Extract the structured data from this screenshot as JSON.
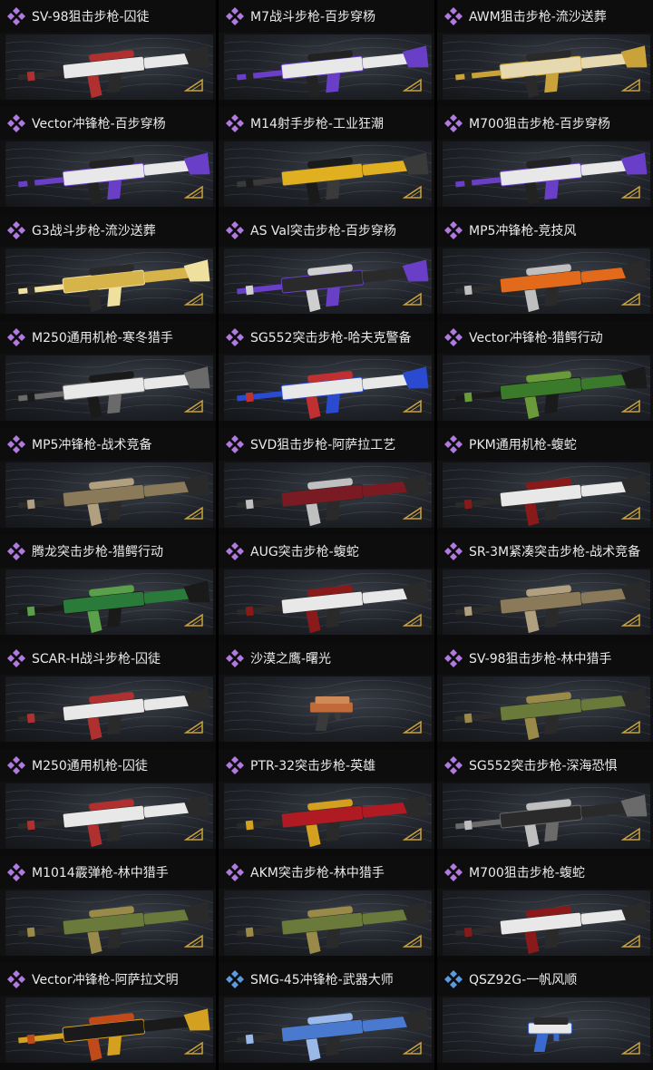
{
  "items": [
    {
      "label": "SV-98狙击步枪-囚徒",
      "rarity": "purple",
      "colors": [
        "#e8e8e8",
        "#2a2a2a",
        "#b03030"
      ]
    },
    {
      "label": "M7战斗步枪-百步穿杨",
      "rarity": "purple",
      "colors": [
        "#e8e8e8",
        "#6a3fc8",
        "#222"
      ]
    },
    {
      "label": "AWM狙击步枪-流沙送葬",
      "rarity": "purple",
      "colors": [
        "#e6d9b0",
        "#c9a23a",
        "#2a2a2a"
      ]
    },
    {
      "label": "Vector冲锋枪-百步穿杨",
      "rarity": "purple",
      "colors": [
        "#e8e8e8",
        "#6a3fc8",
        "#222"
      ]
    },
    {
      "label": "M14射手步枪-工业狂潮",
      "rarity": "purple",
      "colors": [
        "#e0b020",
        "#3a3a3a",
        "#1a1a1a"
      ]
    },
    {
      "label": "M700狙击步枪-百步穿杨",
      "rarity": "purple",
      "colors": [
        "#e8e8e8",
        "#6a3fc8",
        "#222"
      ]
    },
    {
      "label": "G3战斗步枪-流沙送葬",
      "rarity": "purple",
      "colors": [
        "#d6b44a",
        "#f0e0a0",
        "#2a2a2a"
      ]
    },
    {
      "label": "AS Val突击步枪-百步穿杨",
      "rarity": "purple",
      "colors": [
        "#2a2a2a",
        "#6a3fc8",
        "#cfcfcf"
      ]
    },
    {
      "label": "MP5冲锋枪-竞技风",
      "rarity": "purple",
      "colors": [
        "#e36a1a",
        "#2a2a2a",
        "#bfbfbf"
      ]
    },
    {
      "label": "M250通用机枪-寒冬猎手",
      "rarity": "purple",
      "colors": [
        "#e8e8e8",
        "#6a6a6a",
        "#1a1a1a"
      ]
    },
    {
      "label": "SG552突击步枪-哈夫克警备",
      "rarity": "purple",
      "colors": [
        "#e8e8e8",
        "#2a4ad0",
        "#c03030"
      ]
    },
    {
      "label": "Vector冲锋枪-猎鳄行动",
      "rarity": "purple",
      "colors": [
        "#3a7a2a",
        "#1a1a1a",
        "#6a9a3a"
      ]
    },
    {
      "label": "MP5冲锋枪-战术竞备",
      "rarity": "purple",
      "colors": [
        "#8a7a5a",
        "#2a2a2a",
        "#b0a080"
      ]
    },
    {
      "label": "SVD狙击步枪-阿萨拉工艺",
      "rarity": "purple",
      "colors": [
        "#7a1a22",
        "#2a2a2a",
        "#c0c0c0"
      ]
    },
    {
      "label": "PKM通用机枪-蝮蛇",
      "rarity": "purple",
      "colors": [
        "#e8e8e8",
        "#2a2a2a",
        "#8a1a1a"
      ]
    },
    {
      "label": "腾龙突击步枪-猎鳄行动",
      "rarity": "purple",
      "colors": [
        "#2a7a3a",
        "#1a1a1a",
        "#5aa04a"
      ]
    },
    {
      "label": "AUG突击步枪-蝮蛇",
      "rarity": "purple",
      "colors": [
        "#e8e8e8",
        "#2a2a2a",
        "#8a1a1a"
      ]
    },
    {
      "label": "SR-3M紧凑突击步枪-战术竞备",
      "rarity": "purple",
      "colors": [
        "#8a7a5a",
        "#2a2a2a",
        "#b0a080"
      ]
    },
    {
      "label": "SCAR-H战斗步枪-囚徒",
      "rarity": "purple",
      "colors": [
        "#e8e8e8",
        "#2a2a2a",
        "#b03030"
      ]
    },
    {
      "label": "沙漠之鹰-曙光",
      "rarity": "purple",
      "colors": [
        "#c06a3a",
        "#3a3a3a",
        "#d08a5a"
      ]
    },
    {
      "label": "SV-98狙击步枪-林中猎手",
      "rarity": "purple",
      "colors": [
        "#6a7a3a",
        "#2a2a2a",
        "#9a8a4a"
      ]
    },
    {
      "label": "M250通用机枪-囚徒",
      "rarity": "purple",
      "colors": [
        "#e8e8e8",
        "#2a2a2a",
        "#b03030"
      ]
    },
    {
      "label": "PTR-32突击步枪-英雄",
      "rarity": "purple",
      "colors": [
        "#b01a22",
        "#2a2a2a",
        "#d4a020"
      ]
    },
    {
      "label": "SG552突击步枪-深海恐惧",
      "rarity": "purple",
      "colors": [
        "#2a2a2a",
        "#6a6a6a",
        "#bfbfbf"
      ]
    },
    {
      "label": "M1014霰弹枪-林中猎手",
      "rarity": "purple",
      "colors": [
        "#6a7a3a",
        "#2a2a2a",
        "#9a8a4a"
      ]
    },
    {
      "label": "AKM突击步枪-林中猎手",
      "rarity": "purple",
      "colors": [
        "#6a7a3a",
        "#2a2a2a",
        "#9a8a4a"
      ]
    },
    {
      "label": "M700狙击步枪-蝮蛇",
      "rarity": "purple",
      "colors": [
        "#e8e8e8",
        "#2a2a2a",
        "#8a1a1a"
      ]
    },
    {
      "label": "Vector冲锋枪-阿萨拉文明",
      "rarity": "purple",
      "colors": [
        "#1a1a1a",
        "#d4a020",
        "#c04a1a"
      ]
    },
    {
      "label": "SMG-45冲锋枪-武器大师",
      "rarity": "blue",
      "colors": [
        "#4a7ad0",
        "#2a2a2a",
        "#9ab8e8"
      ]
    },
    {
      "label": "QSZ92G-一帆风顺",
      "rarity": "blue",
      "colors": [
        "#e8e8e8",
        "#3a6ad0",
        "#2a2a2a"
      ]
    }
  ],
  "rarity_colors": {
    "purple": "#b07ae0",
    "blue": "#5a9ae0"
  }
}
